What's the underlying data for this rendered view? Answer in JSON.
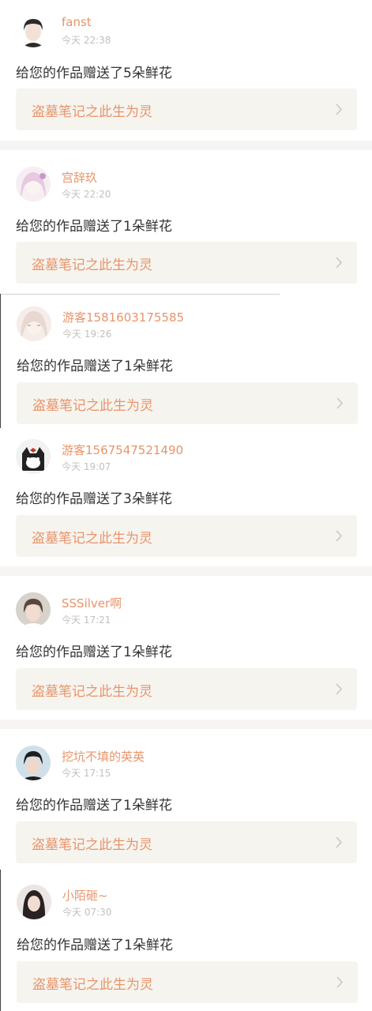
{
  "notifications": [
    {
      "username": "fanst",
      "time": "今天 22:38",
      "message": "给您的作品赠送了5朵鲜花",
      "work_title": "盗墓笔记之此生为灵",
      "avatar_icon": "avatar-boy-dark-hair",
      "avatar_colors": [
        "#2b2b2b",
        "#f3e1d6",
        "#ffffff"
      ]
    },
    {
      "username": "宫辞玖",
      "time": "今天 22:20",
      "message": "给您的作品赠送了1朵鲜花",
      "work_title": "盗墓笔记之此生为灵",
      "avatar_icon": "avatar-anime-pink-hair",
      "avatar_colors": [
        "#e7c9e2",
        "#f7eef4",
        "#c99bc3"
      ]
    },
    {
      "username": "游客1581603175585",
      "time": "今天 19:26",
      "message": "给您的作品赠送了1朵鲜花",
      "work_title": "盗墓笔记之此生为灵",
      "avatar_icon": "avatar-anime-white-hair",
      "avatar_colors": [
        "#e8d8d2",
        "#f6ede9",
        "#c9a8a0"
      ]
    },
    {
      "username": "游客1567547521490",
      "time": "今天 19:07",
      "message": "给您的作品赠送了3朵鲜花",
      "work_title": "盗墓笔记之此生为灵",
      "avatar_icon": "avatar-cartoon-cat",
      "avatar_colors": [
        "#f2f2f2",
        "#222222",
        "#c0392b"
      ]
    },
    {
      "username": "SSSilver啊",
      "time": "今天 17:21",
      "message": "给您的作品赠送了1朵鲜花",
      "work_title": "盗墓笔记之此生为灵",
      "avatar_icon": "avatar-boy-brown-hair",
      "avatar_colors": [
        "#5a463c",
        "#f1dccf",
        "#d8d2cc"
      ]
    },
    {
      "username": "挖坑不填的英英",
      "time": "今天 17:15",
      "message": "给您的作品赠送了1朵鲜花",
      "work_title": "盗墓笔记之此生为灵",
      "avatar_icon": "avatar-boy-black-hair",
      "avatar_colors": [
        "#1e1e1e",
        "#eed8cb",
        "#cfe0ea"
      ]
    },
    {
      "username": "小陌砸~",
      "time": "今天 07:30",
      "message": "给您的作品赠送了1朵鲜花",
      "work_title": "盗墓笔记之此生为灵",
      "avatar_icon": "avatar-girl-dark-hair",
      "avatar_colors": [
        "#2a2222",
        "#f2dcd2",
        "#ebe6e3"
      ]
    }
  ],
  "colors": {
    "username": "#e9946a",
    "work_title": "#e9946a",
    "timestamp": "#c4c0bd",
    "message": "#333333",
    "link_background": "#f6f4ef",
    "separator": "#f7f5f4",
    "chevron": "#c8c8c8"
  },
  "icons": {
    "chevron": "chevron-right-icon"
  }
}
